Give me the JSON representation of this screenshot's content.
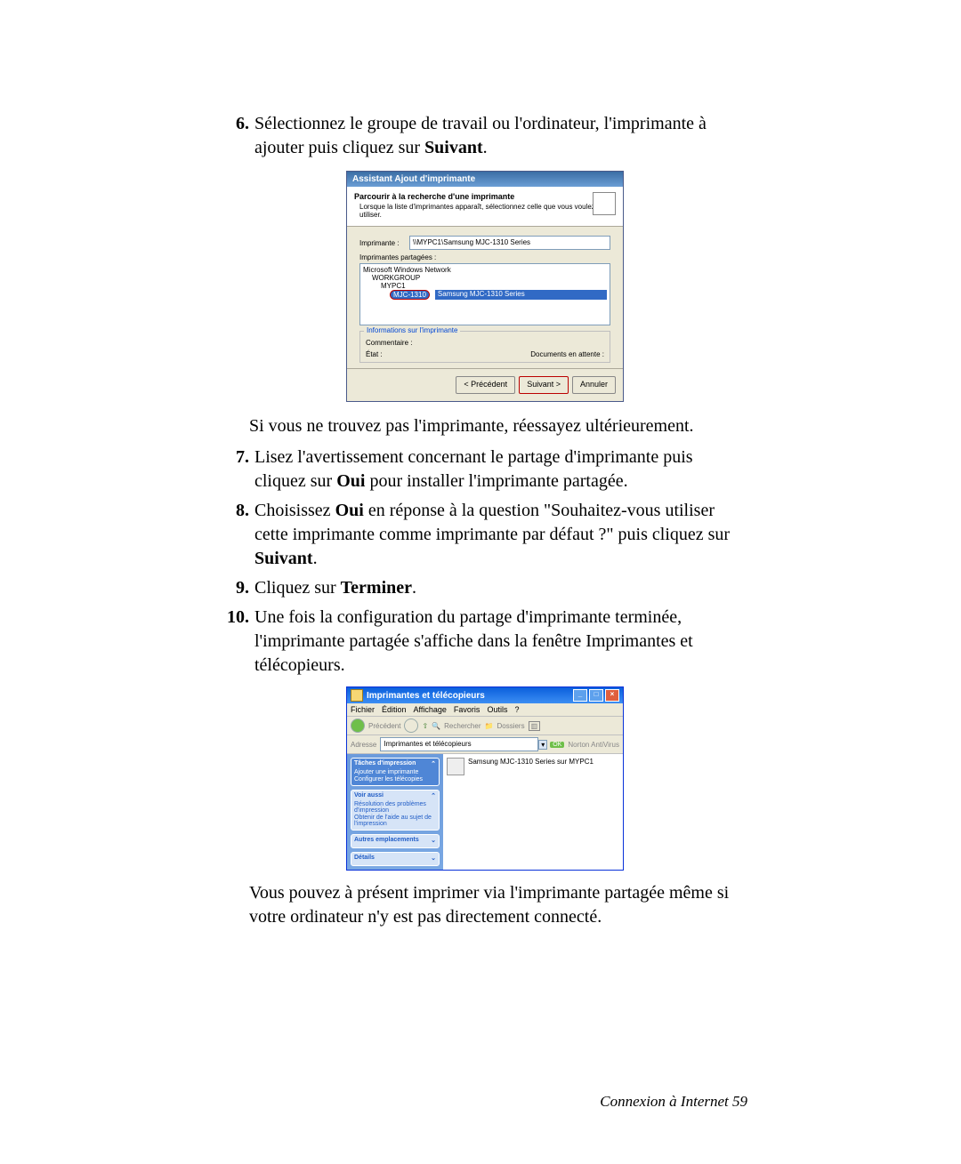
{
  "steps": {
    "s6": {
      "num": "6.",
      "text_a": "Sélectionnez le groupe de travail ou l'ordinateur, l'imprimante à ajouter puis cliquez sur ",
      "bold": "Suivant",
      "text_b": "."
    },
    "after6": "Si vous ne trouvez pas l'imprimante, réessayez ultérieurement.",
    "s7": {
      "num": "7.",
      "text_a": "Lisez l'avertissement concernant le partage d'imprimante puis cliquez sur ",
      "bold": "Oui",
      "text_b": " pour installer l'imprimante partagée."
    },
    "s8": {
      "num": "8.",
      "text_a": "Choisissez ",
      "bold1": "Oui",
      "text_b": " en réponse à la question \"Souhaitez-vous utiliser cette imprimante comme imprimante par défaut ?\" puis cliquez sur ",
      "bold2": "Suivant",
      "text_c": "."
    },
    "s9": {
      "num": "9.",
      "text_a": "Cliquez sur ",
      "bold": "Terminer",
      "text_b": "."
    },
    "s10": {
      "num": "10.",
      "text": "Une fois la configuration du partage d'imprimante terminée, l'imprimante partagée s'affiche dans la fenêtre Imprimantes et télécopieurs."
    },
    "after10": "Vous pouvez à présent imprimer via l'imprimante partagée même si votre ordinateur n'y est pas directement connecté."
  },
  "wizard": {
    "title": "Assistant Ajout d'imprimante",
    "head_title": "Parcourir à la recherche d'une imprimante",
    "head_sub": "Lorsque la liste d'imprimantes apparaît, sélectionnez celle que vous voulez utiliser.",
    "printer_label": "Imprimante :",
    "printer_value": "\\\\MYPC1\\Samsung MJC-1310 Series",
    "shared_label": "Imprimantes partagées :",
    "tree": {
      "r1": "Microsoft Windows Network",
      "r2": "WORKGROUP",
      "r3": "MYPC1",
      "sel_left": "MJC-1310",
      "sel_right": "Samsung MJC-1310 Series"
    },
    "info_legend": "Informations sur l'imprimante",
    "comment_label": "Commentaire :",
    "state_label": "État :",
    "docs_label": "Documents en attente :",
    "btn_back": "< Précédent",
    "btn_next": "Suivant >",
    "btn_cancel": "Annuler"
  },
  "pf": {
    "title": "Imprimantes et télécopieurs",
    "menu": {
      "file": "Fichier",
      "edit": "Édition",
      "view": "Affichage",
      "fav": "Favoris",
      "tools": "Outils",
      "help": "?"
    },
    "toolbar": {
      "back": "Précédent",
      "search": "Rechercher",
      "folders": "Dossiers"
    },
    "address_label": "Adresse",
    "address_value": "Imprimantes et télécopieurs",
    "go": "OK",
    "norton": "Norton AntiVirus",
    "panel1": {
      "head": "Tâches d'impression",
      "link1": "Ajouter une imprimante",
      "link2": "Configurer les télécopies"
    },
    "panel2": {
      "head": "Voir aussi",
      "link1": "Résolution des problèmes d'impression",
      "link2": "Obtenir de l'aide au sujet de l'impression"
    },
    "panel3": {
      "head": "Autres emplacements"
    },
    "panel4": {
      "head": "Détails"
    },
    "printer_name": "Samsung MJC-1310 Series sur MYPC1"
  },
  "footer": "Connexion à Internet   59"
}
